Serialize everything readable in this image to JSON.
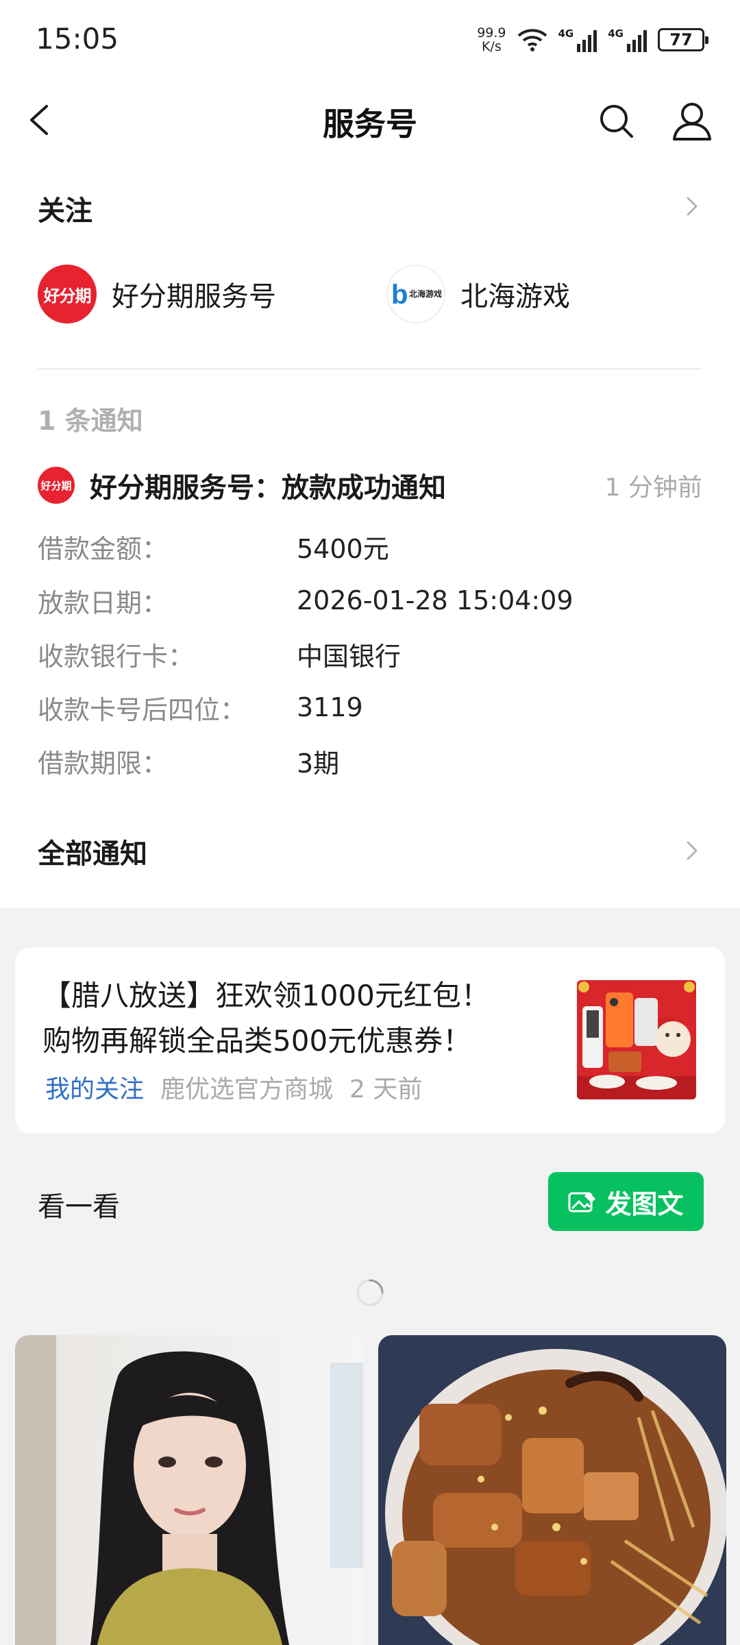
{
  "status_bar": {
    "time": "15:05",
    "net_speed_value": "99.9",
    "net_speed_unit": "K/s",
    "signal1_label": "4G",
    "signal2_label": "4G",
    "battery": "77"
  },
  "nav": {
    "title": "服务号"
  },
  "follow": {
    "title": "关注",
    "accounts": [
      {
        "name": "好分期服务号",
        "avatar_text": "好分期"
      },
      {
        "name": "北海游戏",
        "logo_letter": "b",
        "logo_text": "北海游戏"
      }
    ]
  },
  "notification": {
    "count_label": "1 条通知",
    "avatar_text": "好分期",
    "title": "好分期服务号：放款成功通知",
    "time": "1 分钟前",
    "details": [
      {
        "label": "借款金额：",
        "value": "5400元"
      },
      {
        "label": "放款日期：",
        "value": "2026-01-28 15:04:09"
      },
      {
        "label": "收款银行卡：",
        "value": "中国银行"
      },
      {
        "label": "收款卡号后四位：",
        "value": "3119"
      },
      {
        "label": "借款期限：",
        "value": "3期"
      }
    ],
    "all_label": "全部通知"
  },
  "promo": {
    "line1": "【腊八放送】狂欢领1000元红包！",
    "line2": "购物再解锁全品类500元优惠券！",
    "follow_tag": "我的关注",
    "shop": "鹿优选官方商城",
    "time": "2 天前"
  },
  "look": {
    "title": "看一看",
    "post_button": "发图文"
  },
  "colors": {
    "accent_green": "#07c160",
    "brand_red": "#e6232f",
    "link_blue": "#2f6fc6"
  }
}
